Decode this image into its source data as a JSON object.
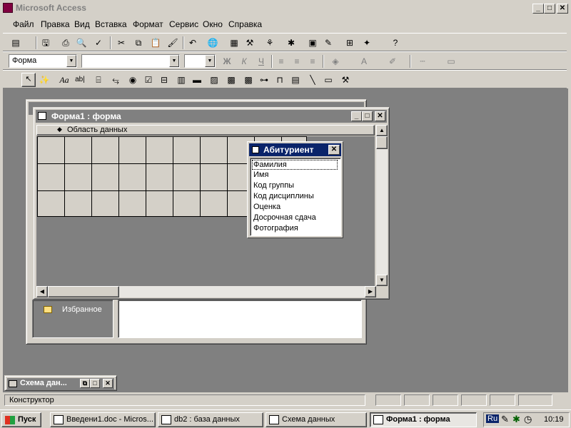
{
  "app": {
    "title": "Microsoft Access"
  },
  "menu": [
    "Файл",
    "Правка",
    "Вид",
    "Вставка",
    "Формат",
    "Сервис",
    "Окно",
    "Справка"
  ],
  "format_toolbar": {
    "object_combo": "Форма",
    "font_combo": "",
    "size_combo": "",
    "bold": "Ж",
    "italic": "К",
    "underline": "Ч",
    "font_color": "A"
  },
  "toolbox": {
    "label_tool": "Aa",
    "textbox_tool": "ab|"
  },
  "form_window": {
    "title": "Форма1 : форма",
    "section": "Область данных"
  },
  "field_list": {
    "title": "Абитуриент",
    "fields": [
      "Фамилия",
      "Имя",
      "Код группы",
      "Код дисциплины",
      "Оценка",
      "Досрочная сдача",
      "Фотография"
    ]
  },
  "db_window": {
    "favorites": "Избранное"
  },
  "schema_window": {
    "title": "Схема дан..."
  },
  "status": {
    "text": "Конструктор"
  },
  "taskbar": {
    "start": "Пуск",
    "tasks": [
      "Введени1.doc - Micros...",
      "db2 : база данных",
      "Схема данных",
      "Форма1 : форма"
    ],
    "lang": "Ru",
    "clock": "10:19"
  },
  "colors": {
    "active_caption": "#0a246a",
    "inactive_caption": "#808080",
    "desktop": "#808080"
  }
}
